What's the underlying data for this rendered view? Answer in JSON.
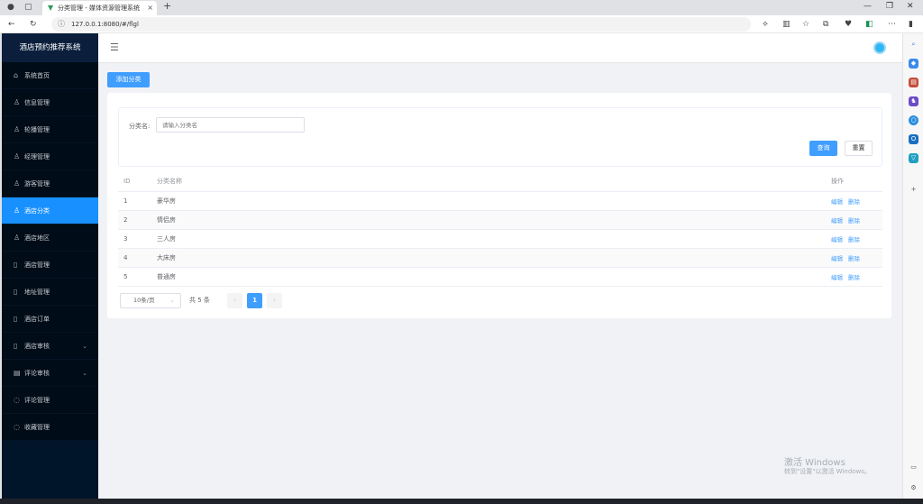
{
  "browser": {
    "tab_title": "分类管理 - 媒体资源管理系统",
    "url": "127.0.0.1:8080/#/flgl"
  },
  "app": {
    "title": "酒店预约推荐系统"
  },
  "sidebar": {
    "items": [
      {
        "label": "系统首页",
        "icon": "home-icon"
      },
      {
        "label": "信息管理",
        "icon": "user-icon"
      },
      {
        "label": "轮播管理",
        "icon": "user-icon"
      },
      {
        "label": "经理管理",
        "icon": "user-icon"
      },
      {
        "label": "游客管理",
        "icon": "user-icon"
      },
      {
        "label": "酒店分类",
        "icon": "user-icon",
        "active": true
      },
      {
        "label": "酒店地区",
        "icon": "user-icon"
      },
      {
        "label": "酒店管理",
        "icon": "document-icon"
      },
      {
        "label": "地址管理",
        "icon": "document-icon"
      },
      {
        "label": "酒店订单",
        "icon": "document-icon"
      },
      {
        "label": "酒店审核",
        "icon": "document-icon",
        "expandable": true
      },
      {
        "label": "评论审核",
        "icon": "list-icon",
        "expandable": true
      },
      {
        "label": "评论管理",
        "icon": "chat-icon"
      },
      {
        "label": "收藏管理",
        "icon": "chat-icon"
      }
    ]
  },
  "toolbar": {
    "add_label": "添加分类"
  },
  "search": {
    "label": "分类名:",
    "placeholder": "请输入分类名",
    "query_label": "查询",
    "reset_label": "重置"
  },
  "table": {
    "headers": {
      "id": "ID",
      "name": "分类名称",
      "ops": "操作"
    },
    "edit_label": "编辑",
    "delete_label": "删除",
    "rows": [
      {
        "id": "1",
        "name": "豪华房"
      },
      {
        "id": "2",
        "name": "情侣房"
      },
      {
        "id": "3",
        "name": "三人房"
      },
      {
        "id": "4",
        "name": "大床房"
      },
      {
        "id": "5",
        "name": "普通房"
      }
    ]
  },
  "pagination": {
    "page_size": "10条/页",
    "total": "共 5 条",
    "current_page": "1",
    "prev": "‹",
    "next": "›"
  },
  "watermark": {
    "line1": "激活 Windows",
    "line2": "转到\"设置\"以激活 Windows。"
  },
  "colors": {
    "sidebar_bg": "#001529",
    "active": "#1890ff",
    "primary": "#409eff"
  }
}
